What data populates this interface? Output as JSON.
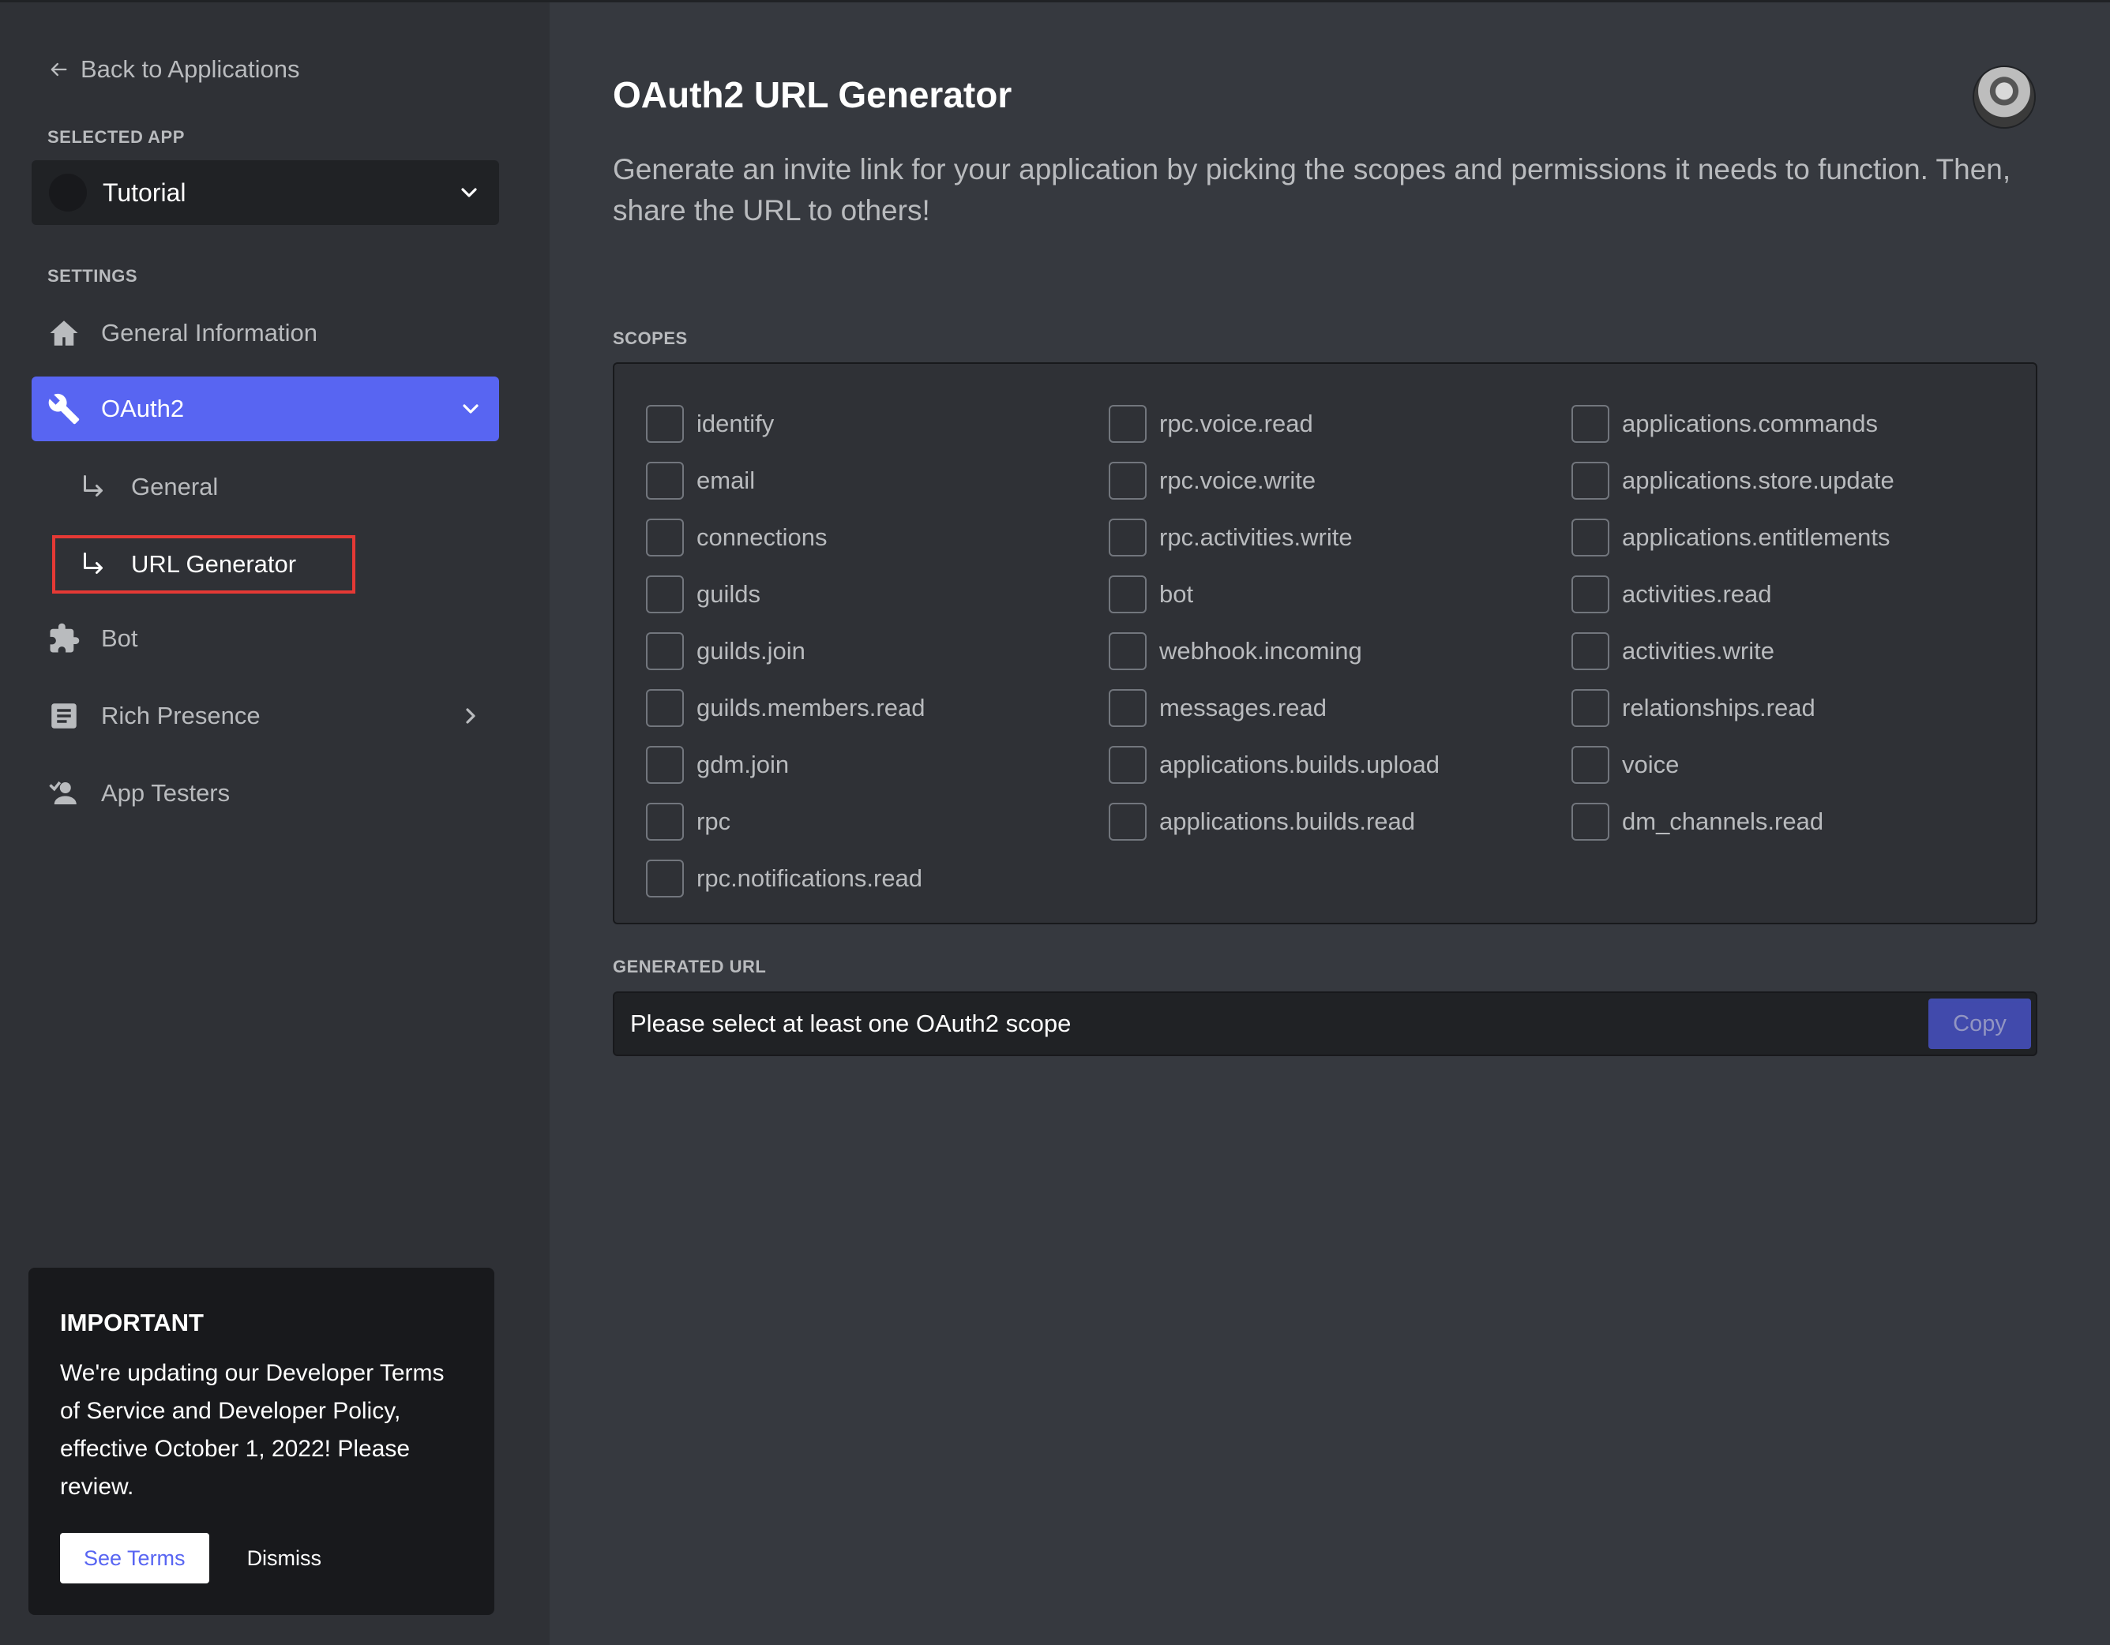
{
  "sidebar": {
    "back_label": "Back to Applications",
    "selected_app_label": "SELECTED APP",
    "selected_app_name": "Tutorial",
    "settings_label": "SETTINGS",
    "nav": {
      "general_information": "General Information",
      "oauth2": "OAuth2",
      "oauth2_general": "General",
      "oauth2_url_generator": "URL Generator",
      "bot": "Bot",
      "rich_presence": "Rich Presence",
      "app_testers": "App Testers"
    },
    "icons": {
      "back": "arrow-left-icon",
      "app_dropdown": "chevron-down-icon",
      "general_information": "home-icon",
      "oauth2": "wrench-icon",
      "oauth2_expand": "chevron-down-icon",
      "sub_item": "arrow-down-right-icon",
      "bot": "puzzle-icon",
      "rich_presence": "document-icon",
      "rich_presence_expand": "chevron-right-icon",
      "app_testers": "person-icon"
    },
    "notice": {
      "title": "IMPORTANT",
      "body": "We're updating our Developer Terms of Service and Developer Policy, effective October 1, 2022! Please review.",
      "see_terms": "See Terms",
      "dismiss": "Dismiss"
    }
  },
  "main": {
    "title": "OAuth2 URL Generator",
    "description": "Generate an invite link for your application by picking the scopes and permissions it needs to function. Then, share the URL to others!",
    "scopes_label": "SCOPES",
    "scopes": {
      "col1": [
        "identify",
        "email",
        "connections",
        "guilds",
        "guilds.join",
        "guilds.members.read",
        "gdm.join",
        "rpc",
        "rpc.notifications.read"
      ],
      "col2": [
        "rpc.voice.read",
        "rpc.voice.write",
        "rpc.activities.write",
        "bot",
        "webhook.incoming",
        "messages.read",
        "applications.builds.upload",
        "applications.builds.read"
      ],
      "col3": [
        "applications.commands",
        "applications.store.update",
        "applications.entitlements",
        "activities.read",
        "activities.write",
        "relationships.read",
        "voice",
        "dm_channels.read"
      ]
    },
    "generated_url_label": "GENERATED URL",
    "generated_url_placeholder": "Please select at least one OAuth2 scope",
    "copy_label": "Copy"
  },
  "colors": {
    "accent": "#5865f2",
    "sidebar_bg": "#2f3136",
    "main_bg": "#36393f",
    "highlight_border": "#e53935"
  }
}
